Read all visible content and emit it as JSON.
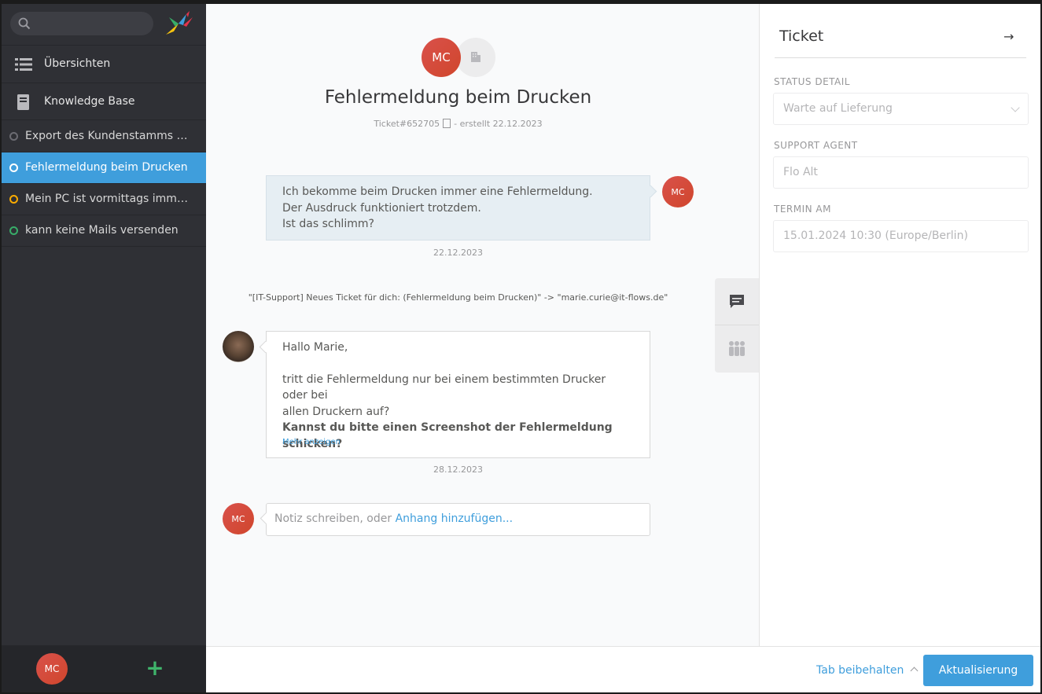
{
  "sidebar": {
    "nav": [
      {
        "label": "Übersichten",
        "icon": "list-icon"
      },
      {
        "label": "Knowledge Base",
        "icon": "book-icon"
      }
    ],
    "tickets": [
      {
        "label": "Export des Kundenstamms dau…",
        "status": "closed",
        "color": "#6b6b72"
      },
      {
        "label": "Fehlermeldung beim Drucken",
        "status": "active",
        "color": "#ffffff"
      },
      {
        "label": "Mein PC ist vormittags immer se…",
        "status": "pending",
        "color": "#faab00"
      },
      {
        "label": "kann keine Mails versenden",
        "status": "open",
        "color": "#38ad69"
      }
    ],
    "footer": {
      "avatar_initials": "MC",
      "add_label": "+"
    }
  },
  "ticket": {
    "avatar_initials": "MC",
    "title": "Fehlermeldung beim Drucken",
    "number": "Ticket#652705",
    "created": "- erstellt 22.12.2023"
  },
  "messages": {
    "customer": {
      "avatar_initials": "MC",
      "lines": [
        "Ich bekomme beim Drucken immer eine Fehlermeldung.",
        "Der Ausdruck funktioniert trotzdem.",
        "Ist das schlimm?"
      ],
      "date": "22.12.2023"
    },
    "system_line": "\"[IT-Support] Neues Ticket für dich: (Fehlermeldung beim Drucken)\" -> \"marie.curie@it-flows.de\"",
    "agent": {
      "greeting": "Hallo Marie,",
      "line1": "tritt die Fehlermeldung nur bei einem bestimmten Drucker oder bei",
      "line2": "allen Druckern auf?",
      "bold": "Kannst du bitte einen Screenshot der Fehlermeldung schicken?",
      "more": "Mehr anzeigen",
      "date": "28.12.2023"
    }
  },
  "compose": {
    "avatar_initials": "MC",
    "placeholder": "Notiz schreiben, oder ",
    "attach": "Anhang hinzufügen..."
  },
  "right_panel": {
    "title": "Ticket",
    "arrow": "→",
    "fields": [
      {
        "label": "STATUS DETAIL",
        "value": "Warte auf Lieferung"
      },
      {
        "label": "SUPPORT AGENT",
        "value": "Flo Alt"
      },
      {
        "label": "TERMIN AM",
        "value": "15.01.2024 10:30 (Europe/Berlin)"
      }
    ]
  },
  "bottom": {
    "keep_tab": "Tab beibehalten",
    "update_button": "Aktualisierung"
  },
  "colors": {
    "accent": "#3f9edc",
    "sidebar": "#2f3035",
    "avatar": "#d9514b",
    "add": "#3fb46b"
  }
}
